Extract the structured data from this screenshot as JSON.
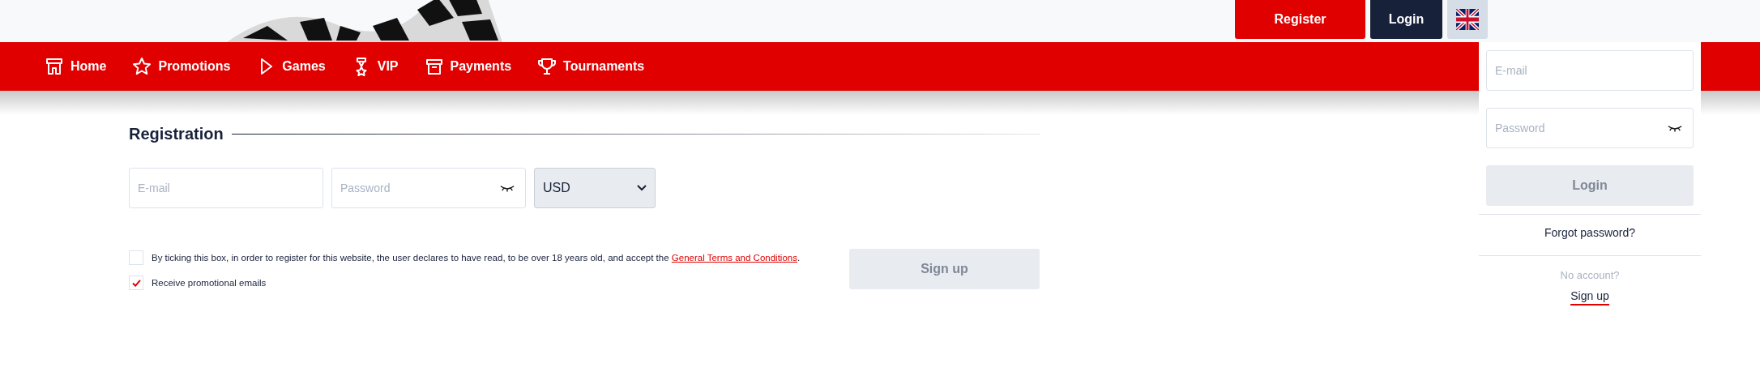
{
  "header": {
    "register_button": "Register",
    "login_button": "Login"
  },
  "nav": {
    "items": [
      {
        "label": "Home"
      },
      {
        "label": "Promotions"
      },
      {
        "label": "Games"
      },
      {
        "label": "VIP"
      },
      {
        "label": "Payments"
      },
      {
        "label": "Tournaments"
      }
    ]
  },
  "registration": {
    "title": "Registration",
    "email": {
      "placeholder": "E-mail"
    },
    "password": {
      "placeholder": "Password"
    },
    "currency": {
      "value": "USD"
    },
    "checkboxes": [
      {
        "text": "By ticking this box, in order to register for this website, the user declares to have read, to be over 18 years old, and accept the ",
        "link": "General Terms and Conditions",
        "after": ".",
        "checked": false
      },
      {
        "text": "Receive promotional emails",
        "checked": true
      }
    ],
    "submit": {
      "label": "Sign up",
      "disabled": true
    }
  },
  "login_panel": {
    "email": {
      "placeholder": "E-mail"
    },
    "password": {
      "placeholder": "Password"
    },
    "submit": {
      "label": "Login",
      "disabled": true
    },
    "forgot": "Forgot password?",
    "no_account": "No account?",
    "signup_link": "Sign up"
  }
}
